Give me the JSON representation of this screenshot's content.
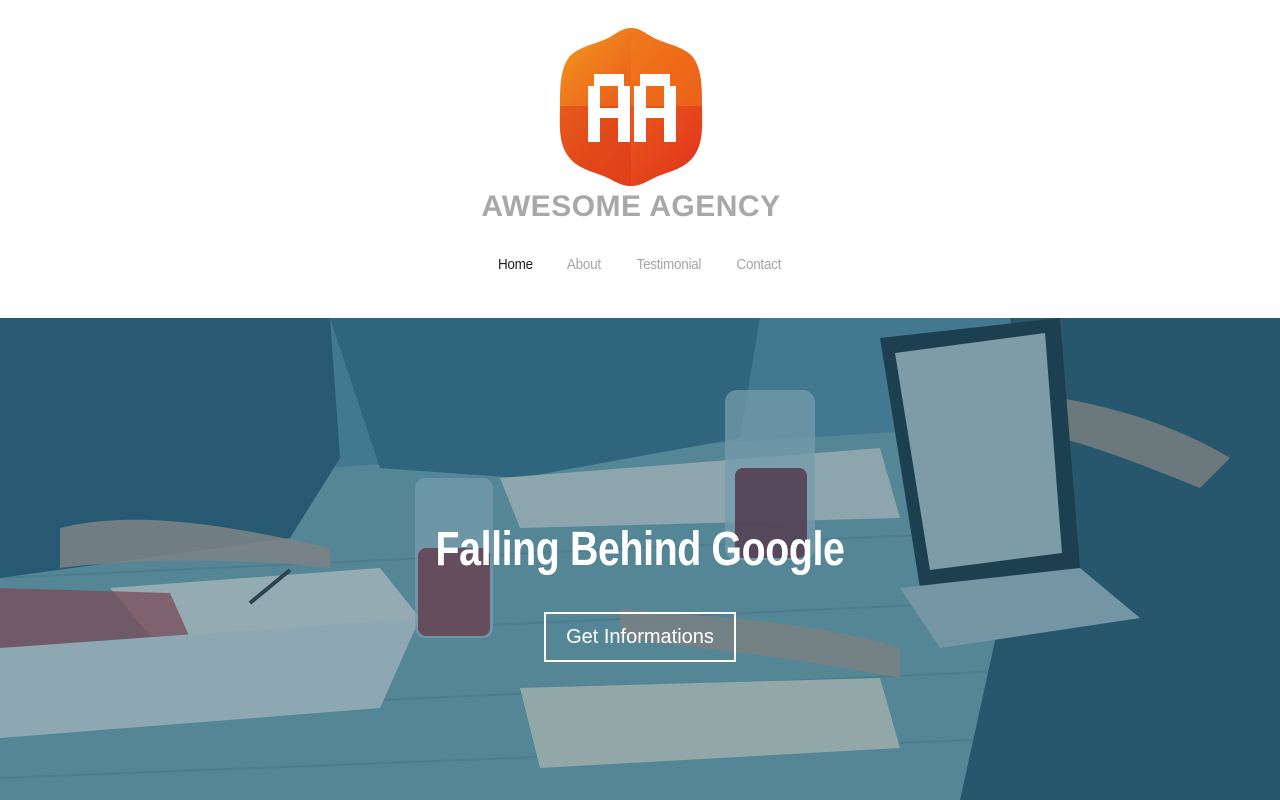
{
  "brand": {
    "name": "AWESOME AGENCY",
    "colors": {
      "primary": "#e8561c",
      "secondary": "#f08a1a",
      "text": "#a8a8a8"
    }
  },
  "nav": {
    "items": [
      {
        "label": "Home",
        "active": true
      },
      {
        "label": "About",
        "active": false
      },
      {
        "label": "Testimonial",
        "active": false
      },
      {
        "label": "Contact",
        "active": false
      }
    ]
  },
  "hero": {
    "title": "Falling Behind Google",
    "cta_label": "Get Informations",
    "overlay_color": "#215a74"
  }
}
